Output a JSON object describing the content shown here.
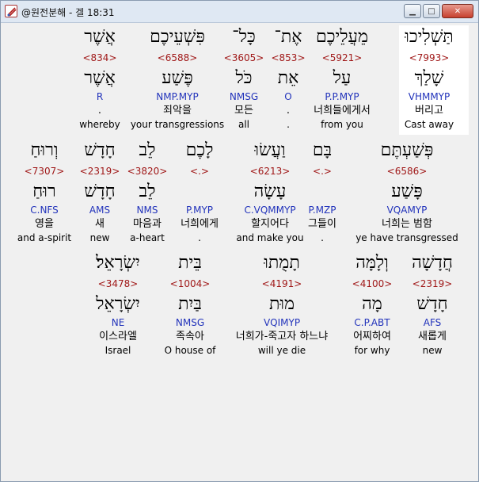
{
  "window": {
    "title": "@원전분해 - 겔 18:31",
    "minimize_label": "▁",
    "maximize_label": "□",
    "close_label": "✕"
  },
  "rows": [
    [
      {
        "heb": "תַּשְׁלִיכוּ",
        "strong": "<7993>",
        "lemma": "שָׁלַךְ",
        "morph": "VHMMYP",
        "korean": "버리고",
        "english": "Cast away"
      },
      {
        "heb": "מֵעֲלֵיכֶם",
        "strong": "<5921>",
        "lemma": "עַל",
        "morph": "P.P.MYP",
        "korean": "너희들에게서",
        "english": "from you"
      },
      {
        "heb": "אֶת־",
        "strong": "<853>",
        "lemma": "אֵת",
        "morph": "O",
        "korean": ".",
        "english": "."
      },
      {
        "heb": "כָּל־",
        "strong": "<3605>",
        "lemma": "כֹּל",
        "morph": "NMSG",
        "korean": "모든",
        "english": "all"
      },
      {
        "heb": "פִּשְׁעֵיכֶם",
        "strong": "<6588>",
        "lemma": "פֶּשַׁע",
        "morph": "NMP.MYP",
        "korean": "죄악을",
        "english": "your transgressions"
      },
      {
        "heb": "אֲשֶׁר",
        "strong": "<834>",
        "lemma": "אֲשֶׁר",
        "morph": "R",
        "korean": ".",
        "english": "whereby"
      }
    ],
    [
      {
        "heb": "פְּשַׁעְתֶּם",
        "strong": "<6586>",
        "lemma": "פָּשַׁע",
        "morph": "VQAMYP",
        "korean": "너희는 범함",
        "english": "ye have transgressed"
      },
      {
        "heb": "בָּם",
        "strong": "<.>",
        "lemma": "",
        "morph": "P.MZP",
        "korean": "그들이",
        "english": "."
      },
      {
        "heb": "וַעֲשׂוּ",
        "strong": "<6213>",
        "lemma": "עָשָׂה",
        "morph": "C.VQMMYP",
        "korean": "할지어다",
        "english": "and make you"
      },
      {
        "heb": "לָכֶם",
        "strong": "<.>",
        "lemma": "",
        "morph": "P.MYP",
        "korean": "너희에게",
        "english": "."
      },
      {
        "heb": "לֵב",
        "strong": "<3820>",
        "lemma": "לֵב",
        "morph": "NMS",
        "korean": "마음과",
        "english": "a-heart"
      },
      {
        "heb": "חָדָשׁ",
        "strong": "<2319>",
        "lemma": "חָדָשׁ",
        "morph": "AMS",
        "korean": "새",
        "english": "new"
      },
      {
        "heb": "וְרוּחַ",
        "strong": "<7307>",
        "lemma": "רוּחַ",
        "morph": "C.NFS",
        "korean": "영을",
        "english": "and a-spirit"
      }
    ],
    [
      {
        "heb": "חֲדָשָׁה",
        "strong": "<2319>",
        "lemma": "חָדָשׁ",
        "morph": "AFS",
        "korean": "새롭게",
        "english": "new"
      },
      {
        "heb": "וְלָמָּה",
        "strong": "<4100>",
        "lemma": "מָה",
        "morph": "C.P.ABT",
        "korean": "어찌하여",
        "english": "for why"
      },
      {
        "heb": "תָמֻתוּ",
        "strong": "<4191>",
        "lemma": "מוּת",
        "morph": "VQIMYP",
        "korean": "너희가-죽고자 하느냐",
        "english": "will ye die"
      },
      {
        "heb": "בֵּית",
        "strong": "<1004>",
        "lemma": "בַּיִת",
        "morph": "NMSG",
        "korean": "족속아",
        "english": "O house of"
      },
      {
        "heb": "יִשְׂרָאֵל׃",
        "strong": "<3478>",
        "lemma": "יִשְׂרָאֵל",
        "morph": "NE",
        "korean": "이스라엘",
        "english": "Israel"
      }
    ]
  ]
}
